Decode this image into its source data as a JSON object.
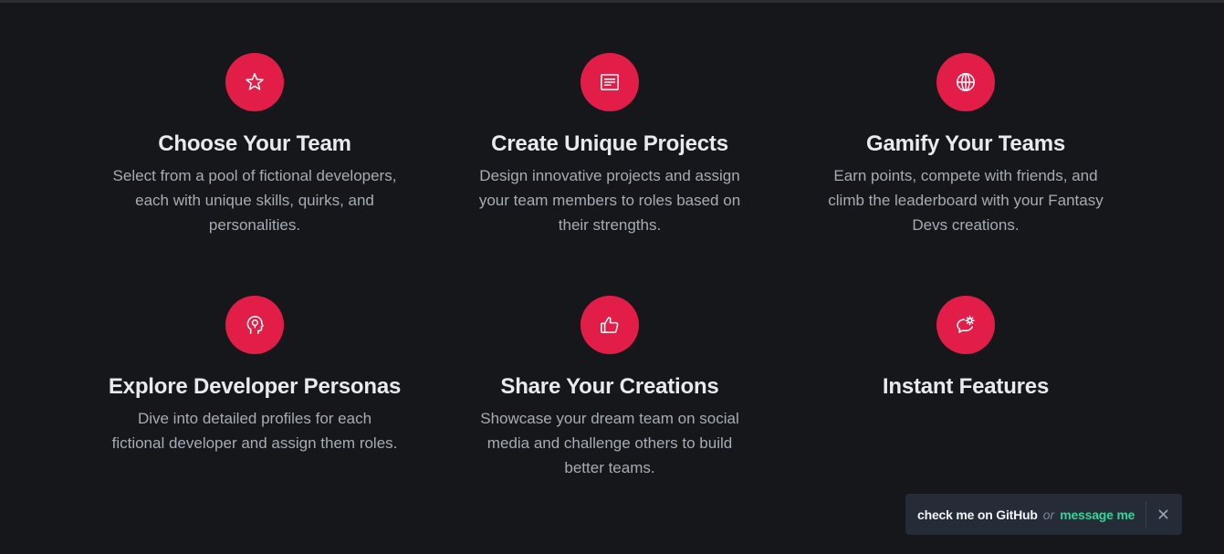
{
  "features": [
    {
      "icon": "star-icon",
      "title": "Choose Your Team",
      "description": "Select from a pool of fictional developers, each with unique skills, quirks, and personalities."
    },
    {
      "icon": "document-icon",
      "title": "Create Unique Projects",
      "description": "Design innovative projects and assign your team members to roles based on their strengths."
    },
    {
      "icon": "globe-icon",
      "title": "Gamify Your Teams",
      "description": "Earn points, compete with friends, and climb the leaderboard with your Fantasy Devs creations."
    },
    {
      "icon": "head-lightbulb-icon",
      "title": "Explore Developer Personas",
      "description": "Dive into detailed profiles for each fictional developer and assign them roles."
    },
    {
      "icon": "thumbs-up-icon",
      "title": "Share Your Creations",
      "description": "Showcase your dream team on social media and challenge others to build better teams."
    },
    {
      "icon": "speech-gear-icon",
      "title": "Instant Features",
      "description": ""
    }
  ],
  "toast": {
    "github_label": "check me on GitHub",
    "or_label": "or",
    "message_label": "message me",
    "close_icon": "close-icon"
  },
  "colors": {
    "background": "#16171a",
    "accent": "#e11d48",
    "link_green": "#34d399"
  }
}
